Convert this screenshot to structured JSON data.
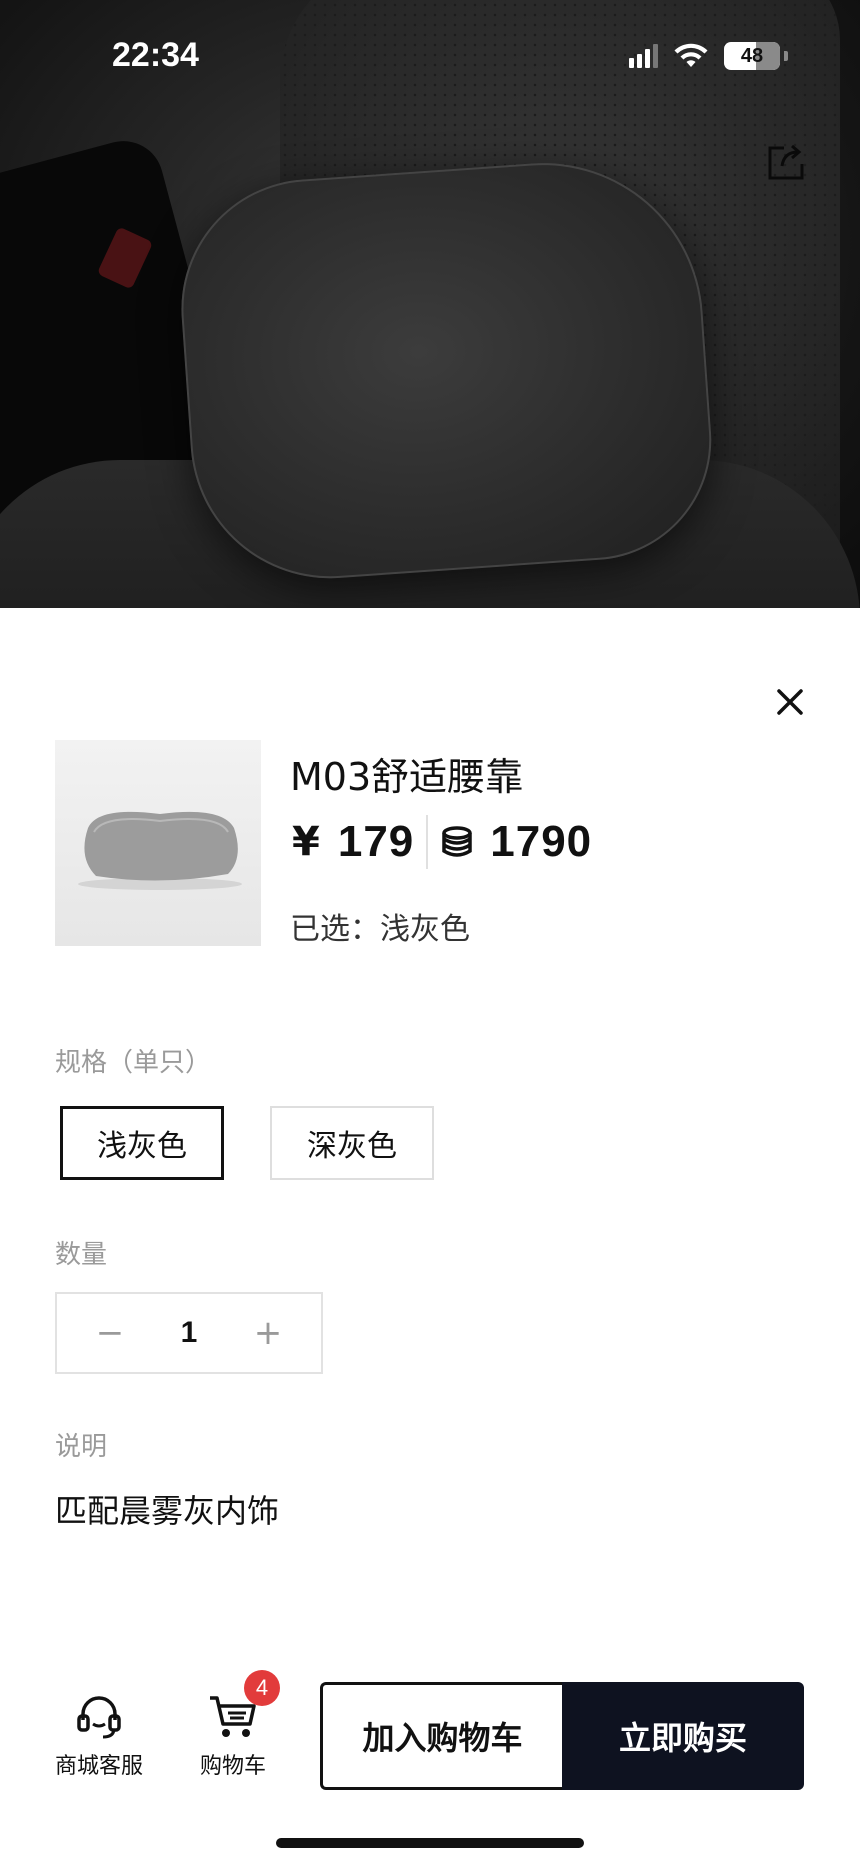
{
  "status_bar": {
    "time": "22:34",
    "battery": "48"
  },
  "product": {
    "title": "M03舒适腰靠",
    "currency_symbol": "¥",
    "price": "179",
    "points": "1790",
    "selected_prefix": "已选：",
    "selected_value": "浅灰色"
  },
  "spec": {
    "label": "规格（单只）",
    "options": [
      {
        "label": "浅灰色",
        "selected": true
      },
      {
        "label": "深灰色",
        "selected": false
      }
    ]
  },
  "quantity": {
    "label": "数量",
    "value": "1",
    "minus_symbol": "−",
    "plus_symbol": "+"
  },
  "description": {
    "label": "说明",
    "text": "匹配晨雾灰内饰"
  },
  "bottom_bar": {
    "service_label": "商城客服",
    "cart_label": "购物车",
    "cart_count": "4",
    "add_to_cart_label": "加入购物车",
    "buy_now_label": "立即购买"
  },
  "icons": {
    "share": "share-icon",
    "close": "close-icon",
    "coin": "coin-icon",
    "headset": "headset-icon",
    "cart": "cart-icon"
  },
  "colors": {
    "buy_button_bg": "#0e1220",
    "badge": "#e23b3b",
    "muted_text": "#9a9a9a"
  }
}
